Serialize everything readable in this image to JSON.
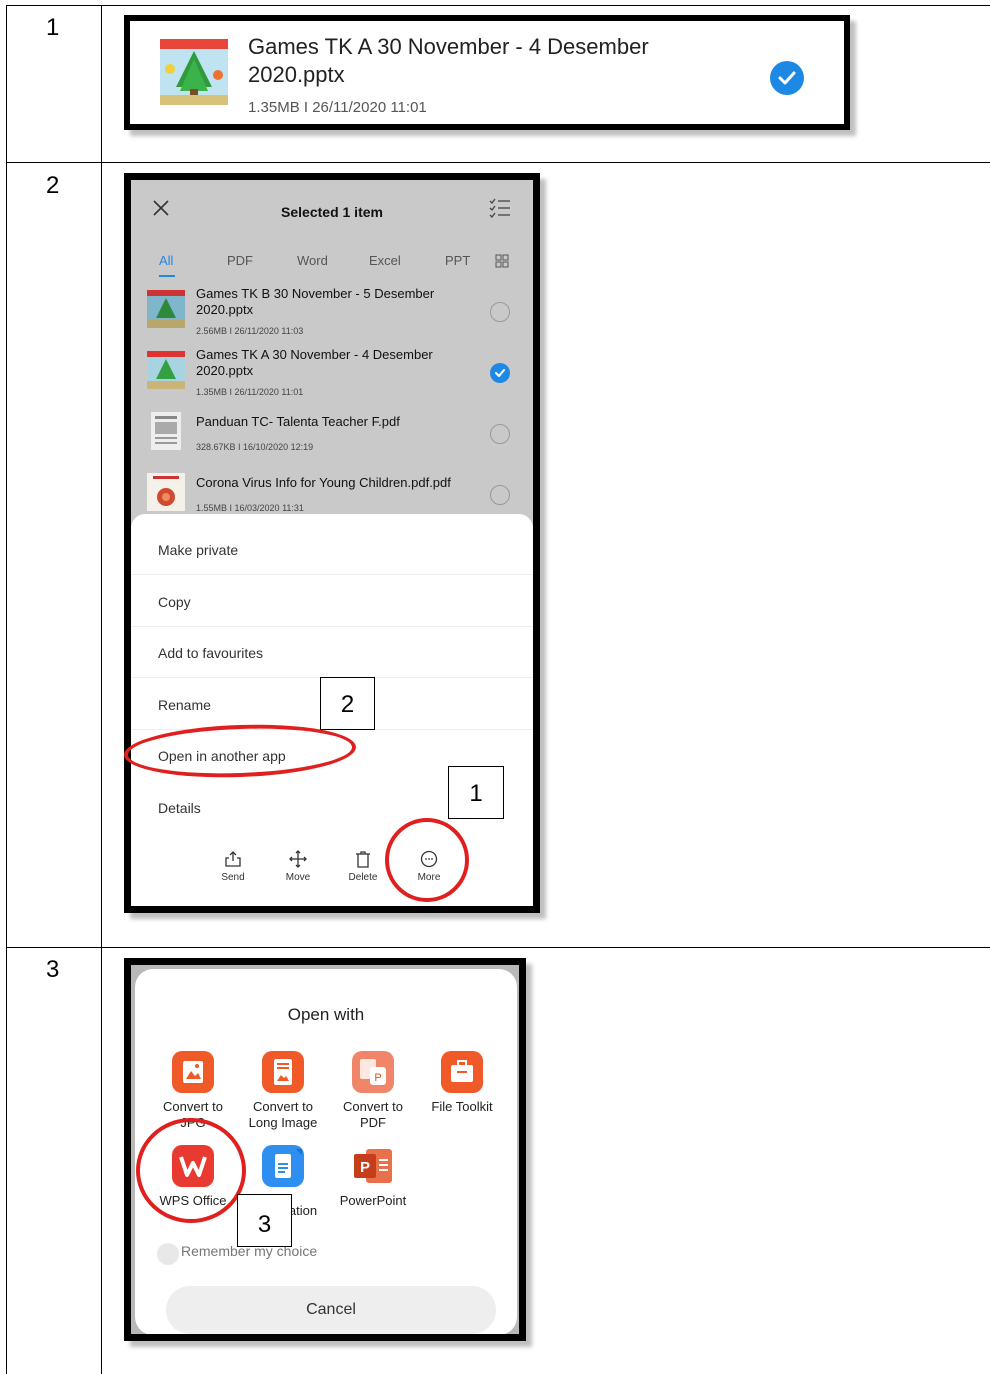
{
  "rows": [
    "1",
    "2",
    "3"
  ],
  "step1": {
    "file_title_line1": "Games TK A 30 November - 4 Desember",
    "file_title_line2": "2020.pptx",
    "file_meta": "1.35MB  I  26/11/2020 11:01"
  },
  "step2": {
    "header_title": "Selected 1 item",
    "tabs": [
      "All",
      "PDF",
      "Word",
      "Excel",
      "PPT"
    ],
    "active_tab": "All",
    "files": [
      {
        "name_line1": "Games TK B 30 November - 5 Desember",
        "name_line2": "2020.pptx",
        "meta": "2.56MB  I  26/11/2020 11:03",
        "selected": false
      },
      {
        "name_line1": "Games TK A 30 November - 4 Desember",
        "name_line2": "2020.pptx",
        "meta": "1.35MB  I  26/11/2020 11:01",
        "selected": true
      },
      {
        "name_line1": "Panduan TC- Talenta Teacher F.pdf",
        "name_line2": "",
        "meta": "328.67KB  I  16/10/2020 12:19",
        "selected": false
      },
      {
        "name_line1": "Corona Virus Info for Young Children.pdf.pdf",
        "name_line2": "",
        "meta": "1.55MB  I  16/03/2020 11:31",
        "selected": false
      }
    ],
    "menu": [
      "Make private",
      "Copy",
      "Add to favourites",
      "Rename",
      "Open in another app",
      "Details"
    ],
    "actions": [
      {
        "label": "Send",
        "icon": "share-icon"
      },
      {
        "label": "Move",
        "icon": "move-icon"
      },
      {
        "label": "Delete",
        "icon": "trash-icon"
      },
      {
        "label": "More",
        "icon": "more-icon"
      }
    ],
    "callout_more": "1",
    "callout_open": "2"
  },
  "step3": {
    "title": "Open with",
    "apps_row1": [
      {
        "label_line1": "Convert to",
        "label_line2": "JPG",
        "icon": "convert-jpg-icon",
        "color": "#f05a28"
      },
      {
        "label_line1": "Convert to",
        "label_line2": "Long Image",
        "icon": "convert-long-image-icon",
        "color": "#f05a28"
      },
      {
        "label_line1": "Convert to",
        "label_line2": "PDF",
        "icon": "convert-pdf-icon",
        "color": "#f05a28"
      },
      {
        "label_line1": "File Toolkit",
        "label_line2": "",
        "icon": "file-toolkit-icon",
        "color": "#f05a28"
      }
    ],
    "apps_row2": [
      {
        "label_line1": "WPS Office",
        "label_line2": "",
        "icon": "wps-office-icon",
        "color": "#e83a30"
      },
      {
        "label_line1": "ation",
        "label_line2": "",
        "icon": "document-app-icon",
        "color": "#2e8ff0"
      },
      {
        "label_line1": "PowerPoint",
        "label_line2": "",
        "icon": "powerpoint-icon",
        "color": "#d24726"
      }
    ],
    "remember": "Remember my choice",
    "cancel": "Cancel",
    "callout_wps": "3"
  },
  "colors": {
    "accent_blue": "#1e88e5",
    "callout_red": "#e0201e"
  }
}
